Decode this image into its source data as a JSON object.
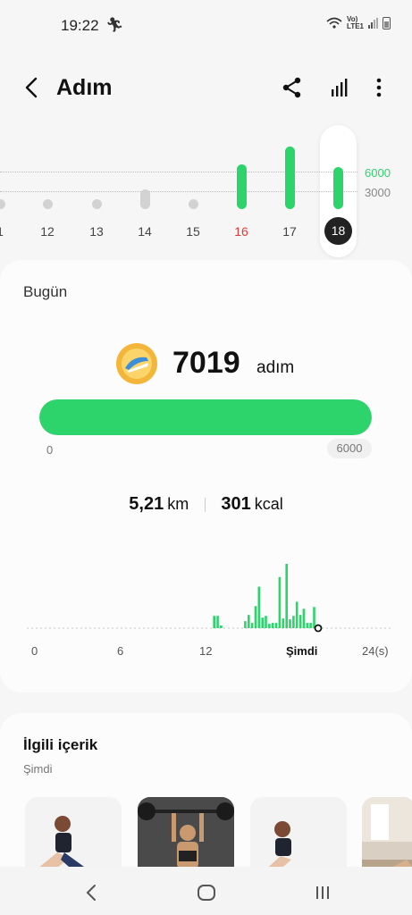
{
  "status_bar": {
    "time": "19:22",
    "network_top": "Vo)",
    "network_bottom": "LTE1"
  },
  "header": {
    "title": "Adım"
  },
  "day_chart": {
    "goal_label": "6000",
    "mid_label": "3000",
    "days": [
      {
        "label": "1",
        "steps": 0
      },
      {
        "label": "12",
        "steps": 0
      },
      {
        "label": "13",
        "steps": 0
      },
      {
        "label": "14",
        "steps": 0
      },
      {
        "label": "15",
        "steps": 0
      },
      {
        "label": "16",
        "steps": 7500
      },
      {
        "label": "17",
        "steps": 10500
      },
      {
        "label": "18",
        "steps": 7019
      }
    ],
    "selected_day": "18",
    "weekend_day": "16",
    "colors": {
      "bar": "#2dd36b",
      "weekend": "#e53935",
      "goal": "#2dd36b"
    }
  },
  "today": {
    "label": "Bugün",
    "steps": "7019",
    "steps_unit": "adım",
    "progress_fraction": 1.0,
    "progress_min": "0",
    "progress_max": "6000",
    "distance": "5,21",
    "distance_unit": "km",
    "calories": "301",
    "calories_unit": "kcal",
    "hourly_chart": {
      "x_labels": [
        "0",
        "6",
        "12",
        "Şimdi",
        "24(s)"
      ],
      "values": [
        0,
        0,
        0,
        0,
        0,
        0,
        0,
        0,
        0,
        0,
        0,
        0,
        0,
        0,
        0,
        0,
        0,
        0,
        0,
        0,
        0,
        0,
        0,
        0,
        0,
        0,
        0,
        0,
        0,
        0,
        0,
        0,
        0,
        0,
        0,
        0,
        0,
        0,
        0,
        0,
        0,
        0,
        0,
        0,
        0,
        0,
        0,
        0,
        0,
        0,
        0,
        0,
        14,
        14,
        3,
        0,
        0,
        0,
        0,
        0,
        0,
        8,
        15,
        6,
        25,
        47,
        12,
        14,
        5,
        6,
        6,
        58,
        11,
        73,
        10,
        14,
        30,
        15,
        22,
        6,
        6,
        24
      ]
    }
  },
  "related": {
    "title": "İlgili içerik",
    "subtitle": "Şimdi",
    "items": [
      "stretch-workout",
      "barbell-workout",
      "stretch-workout-2",
      "home-workout"
    ]
  }
}
